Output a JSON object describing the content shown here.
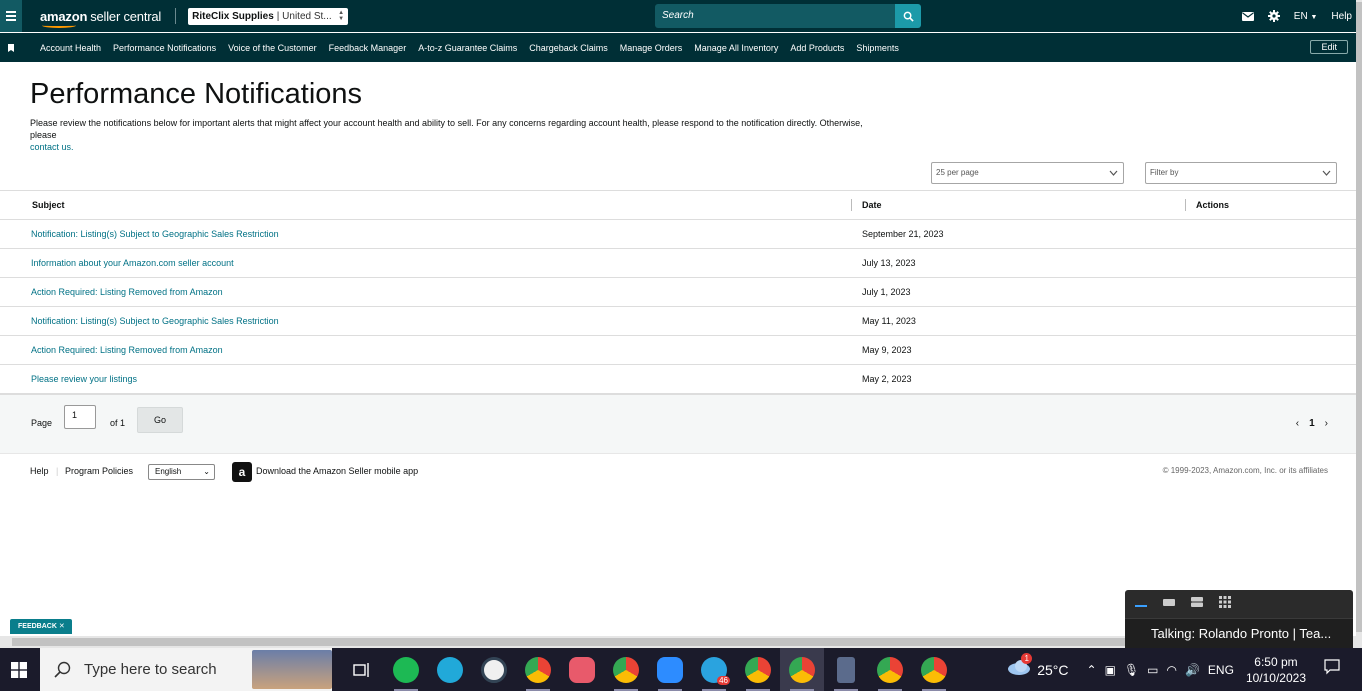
{
  "header": {
    "logo_brand": "amazon",
    "logo_product": "seller central",
    "store_name": "RiteClix Supplies",
    "store_region": "| United St...",
    "search_placeholder": "Search",
    "language": "EN",
    "help": "Help"
  },
  "nav": {
    "items": [
      "Account Health",
      "Performance Notifications",
      "Voice of the Customer",
      "Feedback Manager",
      "A-to-z Guarantee Claims",
      "Chargeback Claims",
      "Manage Orders",
      "Manage All Inventory",
      "Add Products",
      "Shipments"
    ],
    "edit": "Edit"
  },
  "page": {
    "title": "Performance Notifications",
    "description": "Please review the notifications below for important alerts that might affect your account health and ability to sell. For any concerns regarding account health, please respond to the notification directly. Otherwise, please",
    "contact_link": "contact us.",
    "per_page": "25 per page",
    "filter_placeholder": "Filter by"
  },
  "table": {
    "headers": [
      "Subject",
      "Date",
      "Actions"
    ],
    "rows": [
      {
        "subject": "Notification: Listing(s) Subject to Geographic Sales Restriction",
        "date": "September 21, 2023"
      },
      {
        "subject": "Information about your Amazon.com seller account",
        "date": "July 13, 2023"
      },
      {
        "subject": "Action Required: Listing Removed from Amazon",
        "date": "July 1, 2023"
      },
      {
        "subject": "Notification: Listing(s) Subject to Geographic Sales Restriction",
        "date": "May 11, 2023"
      },
      {
        "subject": "Action Required: Listing Removed from Amazon",
        "date": "May 9, 2023"
      },
      {
        "subject": "Please review your listings",
        "date": "May 2, 2023"
      }
    ]
  },
  "pager": {
    "page_label": "Page",
    "page_value": "1",
    "of_label": "of 1",
    "go": "Go",
    "current": "1"
  },
  "footer": {
    "help": "Help",
    "policies": "Program Policies",
    "language": "English",
    "app_text": "Download the Amazon Seller mobile app",
    "copyright": "© 1999-2023, Amazon.com, Inc. or its affiliates"
  },
  "feedback": "FEEDBACK",
  "popup": {
    "talking": "Talking: Rolando Pronto | Tea..."
  },
  "taskbar": {
    "search_placeholder": "Type here to search",
    "weather_badge": "1",
    "temperature": "25°C",
    "input_lang": "ENG",
    "time": "6:50 pm",
    "date": "10/10/2023",
    "telegram_badge": "46"
  },
  "colors": {
    "header_bg": "#002f36",
    "link": "#007185",
    "search_btn": "#1c9aa9"
  }
}
